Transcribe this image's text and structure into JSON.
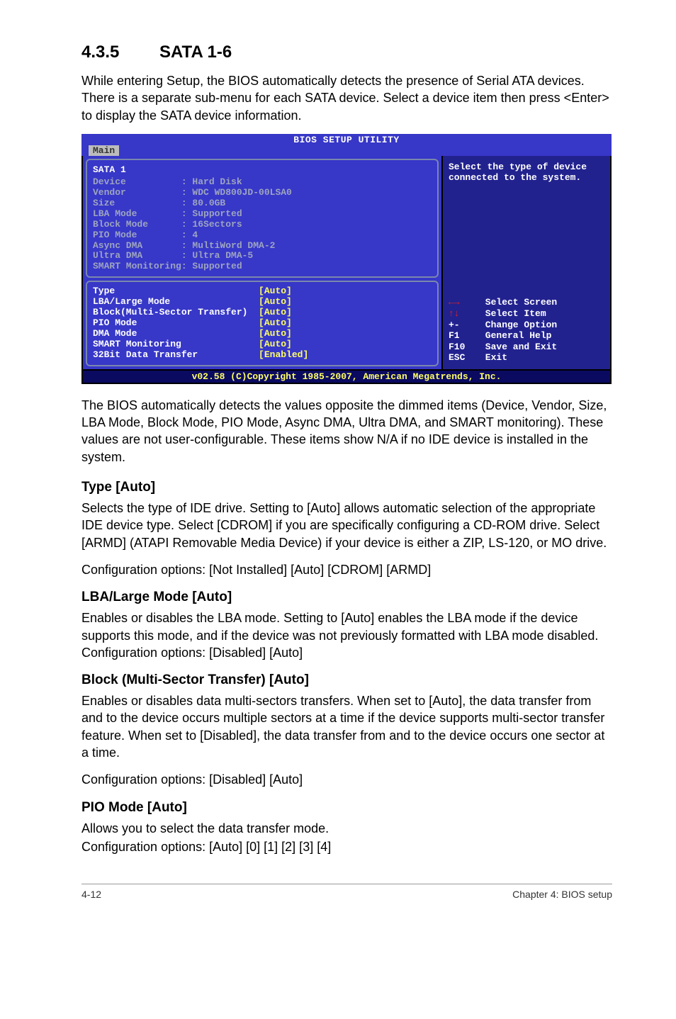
{
  "heading": {
    "number": "4.3.5",
    "title": "SATA 1-6"
  },
  "intro": "While entering Setup, the BIOS automatically detects the presence of Serial ATA devices. There is a separate sub-menu for each SATA device. Select a device item then press <Enter> to display the SATA device information.",
  "bios": {
    "title": "BIOS SETUP UTILITY",
    "tab": "Main",
    "panel_title": "SATA 1",
    "detected": [
      {
        "label": "Device",
        "value": ": Hard Disk"
      },
      {
        "label": "Vendor",
        "value": ": WDC WD800JD-00LSA0"
      },
      {
        "label": "Size",
        "value": ": 80.0GB"
      },
      {
        "label": "LBA Mode",
        "value": ": Supported"
      },
      {
        "label": "Block Mode",
        "value": ": 16Sectors"
      },
      {
        "label": "PIO Mode",
        "value": ": 4"
      },
      {
        "label": "Async DMA",
        "value": ": MultiWord DMA-2"
      },
      {
        "label": "Ultra DMA",
        "value": ": Ultra DMA-5"
      },
      {
        "label": "SMART Monitoring",
        "value": ": Supported"
      }
    ],
    "config": [
      {
        "label": "Type",
        "value": "[Auto]"
      },
      {
        "label": "LBA/Large Mode",
        "value": "[Auto]"
      },
      {
        "label": "Block(Multi-Sector Transfer)",
        "value": "[Auto]"
      },
      {
        "label": "PIO Mode",
        "value": "[Auto]"
      },
      {
        "label": "DMA Mode",
        "value": "[Auto]"
      },
      {
        "label": "SMART Monitoring",
        "value": "[Auto]"
      },
      {
        "label": "32Bit Data Transfer",
        "value": "[Enabled]"
      }
    ],
    "help_text": "Select the type of device connected to the system.",
    "legend": [
      {
        "sym": "←→",
        "red": true,
        "text": "Select Screen"
      },
      {
        "sym": "↑↓",
        "red": true,
        "text": "Select Item"
      },
      {
        "sym": "+-",
        "red": false,
        "text": "Change Option"
      },
      {
        "sym": "F1",
        "red": false,
        "text": "General Help"
      },
      {
        "sym": "F10",
        "red": false,
        "text": "Save and Exit"
      },
      {
        "sym": "ESC",
        "red": false,
        "text": "Exit"
      }
    ],
    "footer": "v02.58 (C)Copyright 1985-2007, American Megatrends, Inc."
  },
  "after_bios": "The BIOS automatically detects the values opposite the dimmed items (Device, Vendor, Size, LBA Mode, Block Mode, PIO Mode, Async DMA, Ultra DMA, and SMART monitoring). These values are not user-configurable. These items show N/A if no IDE device is installed in the system.",
  "sections": {
    "type": {
      "title": "Type [Auto]",
      "p1": "Selects the type of IDE drive. Setting to [Auto] allows automatic selection of the appropriate IDE device type. Select [CDROM] if you are specifically configuring a CD-ROM drive. Select [ARMD] (ATAPI Removable Media Device) if your device is either a ZIP, LS-120, or MO drive.",
      "p2": "Configuration options: [Not Installed] [Auto] [CDROM] [ARMD]"
    },
    "lba": {
      "title": "LBA/Large Mode [Auto]",
      "p1": "Enables or disables the LBA mode. Setting to [Auto] enables the LBA mode if the device supports this mode, and if the device was not previously formatted with LBA mode disabled. Configuration options: [Disabled] [Auto]"
    },
    "block": {
      "title": "Block (Multi-Sector Transfer) [Auto]",
      "p1": "Enables or disables data multi-sectors transfers. When set to [Auto], the data transfer from and to the device occurs multiple sectors at a time if the device supports multi-sector transfer feature. When set to [Disabled], the data transfer from and to the device occurs one sector at a time.",
      "p2": "Configuration options: [Disabled] [Auto]"
    },
    "pio": {
      "title": "PIO Mode [Auto]",
      "p1": "Allows you to select the data transfer mode.",
      "p2": "Configuration options: [Auto] [0] [1] [2] [3] [4]"
    }
  },
  "footer": {
    "left": "4-12",
    "right": "Chapter 4: BIOS setup"
  }
}
